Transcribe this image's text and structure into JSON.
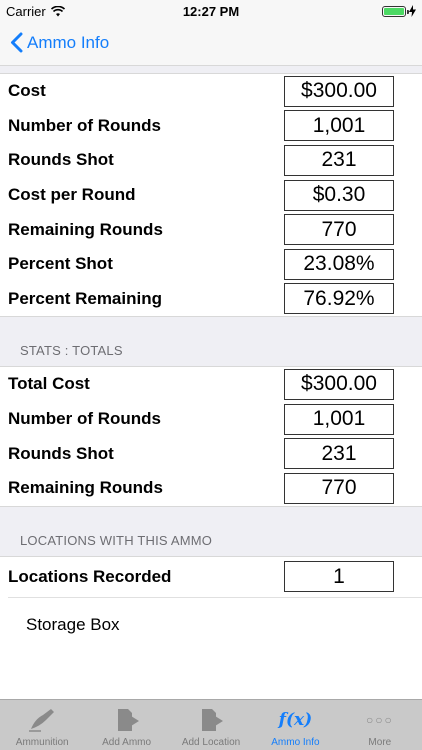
{
  "status_bar": {
    "carrier": "Carrier",
    "time": "12:27 PM"
  },
  "nav": {
    "back_label": "Ammo Info"
  },
  "stats": [
    {
      "label": "Cost",
      "value": "$300.00"
    },
    {
      "label": "Number of Rounds",
      "value": "1,001"
    },
    {
      "label": "Rounds Shot",
      "value": "231"
    },
    {
      "label": "Cost per Round",
      "value": "$0.30"
    },
    {
      "label": "Remaining Rounds",
      "value": "770"
    },
    {
      "label": "Percent Shot",
      "value": "23.08%"
    },
    {
      "label": "Percent Remaining",
      "value": "76.92%"
    }
  ],
  "totals": {
    "header": "STATS : TOTALS",
    "rows": [
      {
        "label": "Total Cost",
        "value": "$300.00"
      },
      {
        "label": "Number of Rounds",
        "value": "1,001"
      },
      {
        "label": "Rounds Shot",
        "value": "231"
      },
      {
        "label": "Remaining Rounds",
        "value": "770"
      }
    ]
  },
  "locations": {
    "header": "LOCATIONS WITH THIS AMMO",
    "recorded_label": "Locations Recorded",
    "recorded_value": "1",
    "items": [
      "Storage Box"
    ]
  },
  "tabs": [
    {
      "label": "Ammunition",
      "icon": "pen-icon"
    },
    {
      "label": "Add Ammo",
      "icon": "add-document-icon"
    },
    {
      "label": "Add Location",
      "icon": "add-document-icon"
    },
    {
      "label": "Ammo Info",
      "icon": "function-icon",
      "active": true
    },
    {
      "label": "More",
      "icon": "more-icon"
    }
  ]
}
